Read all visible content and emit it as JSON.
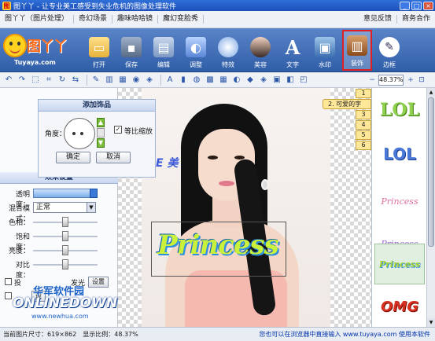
{
  "window": {
    "title": "图丫丫 - 让专业美工感受到失业危机的图像处理软件",
    "min": "_",
    "max": "□",
    "close": "×"
  },
  "menu": {
    "left": [
      "图丫丫（图片处理）",
      "奇幻场景",
      "趣味哈哈镜",
      "魔幻变脸秀"
    ],
    "right": [
      "意见反馈",
      "商务合作"
    ]
  },
  "logo": {
    "letters": "图丫丫",
    "domain": "Tuyaya.com"
  },
  "toolbar": {
    "items": [
      {
        "label": "打开",
        "icon": "folder-icon"
      },
      {
        "label": "保存",
        "icon": "save-icon"
      },
      {
        "label": "编辑",
        "icon": "edit-icon"
      },
      {
        "label": "调整",
        "icon": "adjust-icon"
      },
      {
        "label": "特效",
        "icon": "effect-icon"
      },
      {
        "label": "美容",
        "icon": "beauty-icon"
      },
      {
        "label": "文字",
        "icon": "text-icon"
      },
      {
        "label": "水印",
        "icon": "watermark-icon"
      },
      {
        "label": "装饰",
        "icon": "decoration-icon",
        "active": true
      },
      {
        "label": "边框",
        "icon": "border-icon"
      }
    ]
  },
  "subbar": {
    "zoom": "48.37%"
  },
  "add_decoration": {
    "title": "添加饰品",
    "angle_label": "角度：",
    "keep_ratio_label": "等比缩放",
    "keep_ratio_checked": true,
    "ok": "确定",
    "cancel": "取消"
  },
  "effect_settings": {
    "title": "效果设置",
    "opacity_label": "透明度：",
    "blend_label": "混合模式：",
    "blend_value": "正常",
    "hue_label": "色相：",
    "saturation_label": "饱和度：",
    "brightness_label": "亮度：",
    "contrast_label": "对比度：",
    "opt1": "投",
    "opt2": "发光",
    "settings": "设置",
    "settings2": "设"
  },
  "canvas": {
    "decoration_text": "Princess",
    "side_mark": "E 美"
  },
  "decor_tabs": {
    "active": "2. 可爱的字",
    "numbers": [
      "1",
      "3",
      "4",
      "5",
      "6"
    ]
  },
  "decor_items": [
    {
      "text": "LOL",
      "color": "#8fd14f"
    },
    {
      "text": "LOL",
      "color": "#4a78d8"
    },
    {
      "text": "Princess",
      "color": "#e070a0"
    },
    {
      "text": "Princess",
      "color": "#9a6ad0"
    },
    {
      "text": "Princess",
      "color": "#c8e84a",
      "selected": true
    },
    {
      "text": "OMG",
      "color": "#d83020"
    }
  ],
  "status": {
    "left": "当前图片尺寸：619×862　显示比例：48.37%",
    "right": "您也可以在浏览器中直接输入 www.tuyaya.com 使用本软件"
  },
  "site_watermark": {
    "cn": "华军软件园",
    "en": "ONLINEDOWN",
    "url": "www.newhua.com"
  }
}
